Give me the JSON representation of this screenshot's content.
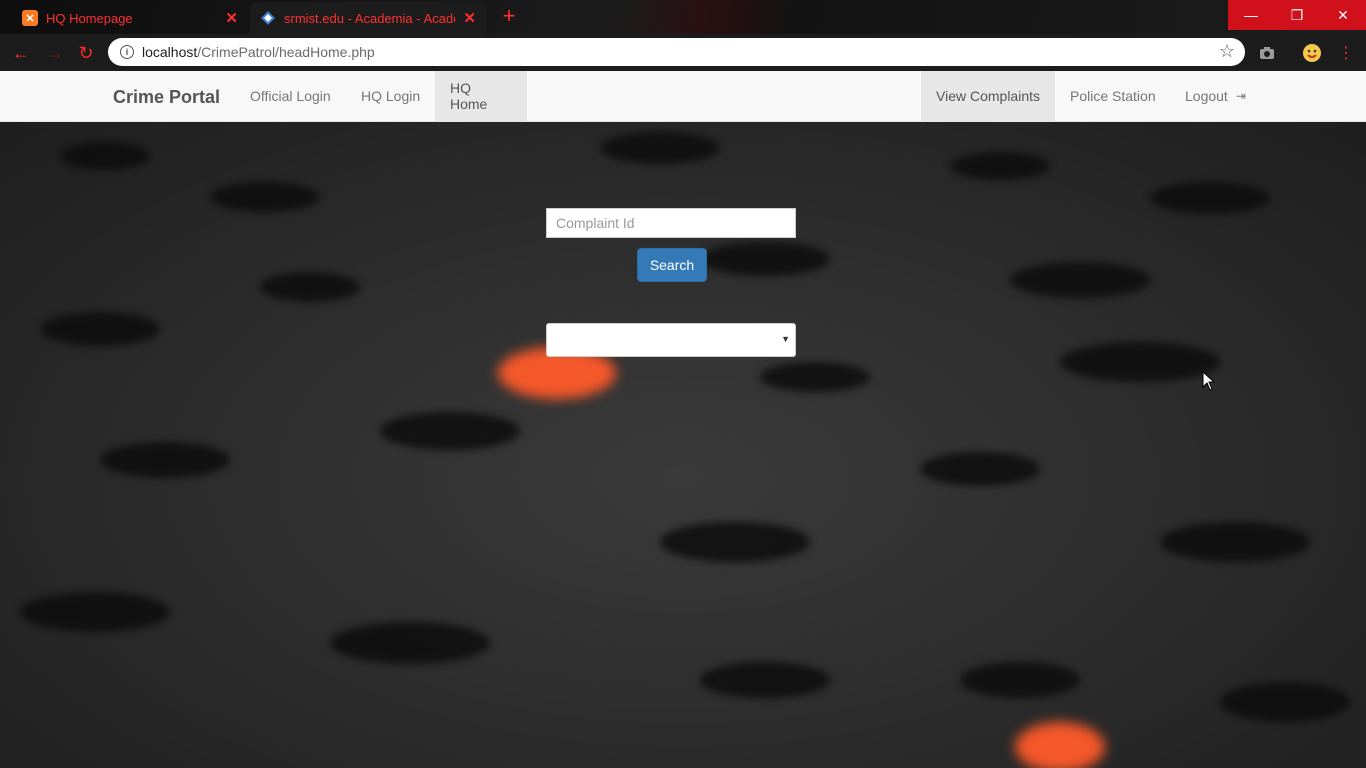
{
  "browser": {
    "tabs": [
      {
        "title": "HQ Homepage",
        "active": false
      },
      {
        "title": "srmist.edu - Academia - Academ",
        "active": true
      }
    ],
    "url_host": "localhost",
    "url_path": "/CrimePatrol/headHome.php",
    "accent_color": "#ff3030"
  },
  "navbar": {
    "brand": "Crime Portal",
    "left_links": [
      "Official Login",
      "HQ Login",
      "HQ Home"
    ],
    "active_left": "HQ Home",
    "right_links": [
      "View Complaints",
      "Police Station",
      "Logout"
    ],
    "active_right": "View Complaints"
  },
  "search": {
    "placeholder": "Complaint Id",
    "button_label": "Search",
    "button_color": "#337ab7",
    "select_value": ""
  }
}
